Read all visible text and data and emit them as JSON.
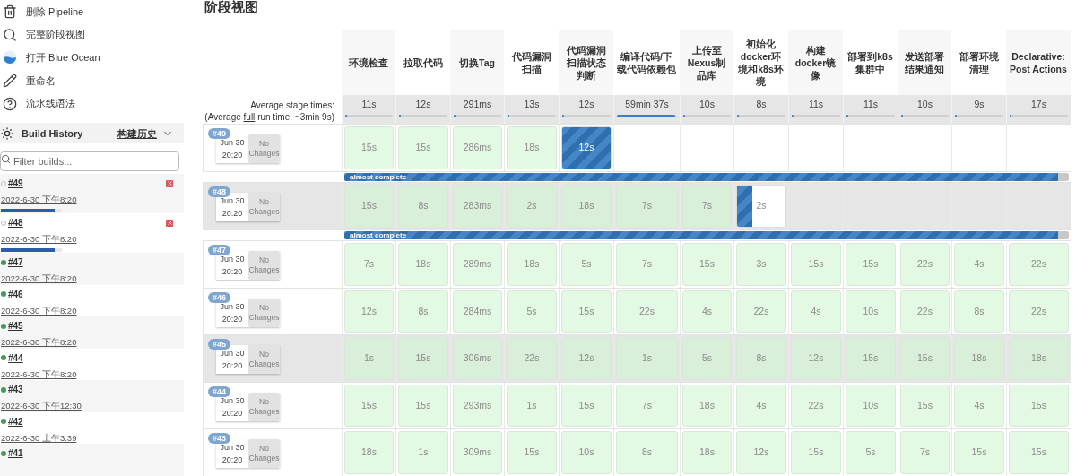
{
  "sidebar": {
    "menu": [
      {
        "kind": "trash",
        "label": "删除 Pipeline"
      },
      {
        "kind": "search",
        "label": "完整阶段视图"
      },
      {
        "kind": "ocean",
        "label": "打开 Blue Ocean"
      },
      {
        "kind": "pencil",
        "label": "重命名"
      },
      {
        "kind": "help",
        "label": "流水线语法"
      }
    ]
  },
  "build_history": {
    "title": "Build History",
    "link": "构建历史",
    "filter": {
      "placeholder": "Filter builds..."
    },
    "builds": [
      {
        "number": "#49",
        "date": "2022-6-30 下午8:20",
        "kind": "running",
        "level": 0.88,
        "cancellable": true
      },
      {
        "number": "#48",
        "date": "2022-6-30 下午8:20",
        "kind": "running",
        "level": 0.88,
        "cancellable": true
      },
      {
        "number": "#47",
        "date": "2022-6-30 下午8:20",
        "kind": "success",
        "cancellable": false
      },
      {
        "number": "#46",
        "date": "2022-6-30 下午8:20",
        "kind": "success",
        "cancellable": false
      },
      {
        "number": "#45",
        "date": "2022-6-30 下午8:20",
        "kind": "success",
        "cancellable": false
      },
      {
        "number": "#44",
        "date": "2022-6-30 下午8:20",
        "kind": "success",
        "cancellable": false
      },
      {
        "number": "#43",
        "date": "2022-6-30 下午12:30",
        "kind": "success",
        "cancellable": false
      },
      {
        "number": "#42",
        "date": "2022-6-30 上午3:39",
        "kind": "success",
        "cancellable": false
      },
      {
        "number": "#41",
        "kind": "success",
        "cancellable": false
      }
    ]
  },
  "stage_view": {
    "title": "阶段视图",
    "average_label": "Average stage times:",
    "average_note": {
      "before": "(Average",
      "link": "full",
      "after": "run time: ~3min 9s)"
    },
    "stages": [
      {
        "name": "环境检查",
        "average": "11s",
        "level": 0.03
      },
      {
        "name": "拉取代码",
        "average": "12s",
        "level": 0.03
      },
      {
        "name": "切换Tag",
        "average": "291ms",
        "level": 0.03
      },
      {
        "name": "代码漏洞扫描",
        "average": "13s",
        "level": 0.03
      },
      {
        "name": "代码漏洞扫描状态判断",
        "average": "12s",
        "level": 0.03
      },
      {
        "name": "编译代码/下载代码依赖包",
        "average": "59min 37s",
        "level": 0.97
      },
      {
        "name": "上传至Nexus制品库",
        "average": "10s",
        "level": 0.03
      },
      {
        "name": "初始化docker环境和k8s环境",
        "average": "8s",
        "level": 0.03
      },
      {
        "name": "构建docker镜像",
        "average": "11s",
        "level": 0.03
      },
      {
        "name": "部署到k8s集群中",
        "average": "11s",
        "level": 0.03
      },
      {
        "name": "发送部署结果通知",
        "average": "10s",
        "level": 0.03
      },
      {
        "name": "部署环境清理",
        "average": "9s",
        "level": 0.03
      },
      {
        "name": "Declarative: Post Actions",
        "average": "17s",
        "level": 0.03
      }
    ],
    "builds": [
      {
        "number": "#49",
        "date": "Jun 30",
        "time": "20:20",
        "changes": "No Changes",
        "shaded": false,
        "progress": {
          "label": "almost complete",
          "level": 0.985
        },
        "cells": [
          {
            "kind": "success",
            "time": "15s"
          },
          {
            "kind": "success",
            "time": "15s"
          },
          {
            "kind": "success",
            "time": "286ms"
          },
          {
            "kind": "success",
            "time": "18s"
          },
          {
            "kind": "running",
            "time": "12s",
            "level": 1
          },
          {
            "kind": "not_run"
          },
          {
            "kind": "not_run"
          },
          {
            "kind": "not_run"
          },
          {
            "kind": "not_run"
          },
          {
            "kind": "not_run"
          },
          {
            "kind": "not_run"
          },
          {
            "kind": "not_run"
          },
          {
            "kind": "not_run"
          }
        ]
      },
      {
        "number": "#48",
        "date": "Jun 30",
        "time": "20:20",
        "changes": "No Changes",
        "shaded": true,
        "progress": {
          "label": "almost complete",
          "level": 0.985
        },
        "cells": [
          {
            "kind": "success",
            "time": "15s"
          },
          {
            "kind": "success",
            "time": "8s"
          },
          {
            "kind": "success",
            "time": "283ms"
          },
          {
            "kind": "success",
            "time": "2s"
          },
          {
            "kind": "success",
            "time": "18s"
          },
          {
            "kind": "success",
            "time": "7s"
          },
          {
            "kind": "success",
            "time": "7s"
          },
          {
            "kind": "running",
            "time": "2s",
            "level": 0.32
          },
          {
            "kind": "not_run"
          },
          {
            "kind": "not_run"
          },
          {
            "kind": "not_run"
          },
          {
            "kind": "not_run"
          },
          {
            "kind": "not_run"
          }
        ]
      },
      {
        "number": "#47",
        "date": "Jun 30",
        "time": "20:20",
        "changes": "No Changes",
        "shaded": false,
        "cells": [
          {
            "kind": "success",
            "time": "7s"
          },
          {
            "kind": "success",
            "time": "18s"
          },
          {
            "kind": "success",
            "time": "289ms"
          },
          {
            "kind": "success",
            "time": "18s"
          },
          {
            "kind": "success",
            "time": "5s"
          },
          {
            "kind": "success",
            "time": "7s"
          },
          {
            "kind": "success",
            "time": "15s"
          },
          {
            "kind": "success",
            "time": "3s"
          },
          {
            "kind": "success",
            "time": "15s"
          },
          {
            "kind": "success",
            "time": "15s"
          },
          {
            "kind": "success",
            "time": "22s"
          },
          {
            "kind": "success",
            "time": "4s"
          },
          {
            "kind": "success",
            "time": "22s"
          }
        ]
      },
      {
        "number": "#46",
        "date": "Jun 30",
        "time": "20:20",
        "changes": "No Changes",
        "shaded": false,
        "cells": [
          {
            "kind": "success",
            "time": "12s"
          },
          {
            "kind": "success",
            "time": "8s"
          },
          {
            "kind": "success",
            "time": "284ms"
          },
          {
            "kind": "success",
            "time": "5s"
          },
          {
            "kind": "success",
            "time": "15s"
          },
          {
            "kind": "success",
            "time": "22s"
          },
          {
            "kind": "success",
            "time": "4s"
          },
          {
            "kind": "success",
            "time": "22s"
          },
          {
            "kind": "success",
            "time": "4s"
          },
          {
            "kind": "success",
            "time": "10s"
          },
          {
            "kind": "success",
            "time": "22s"
          },
          {
            "kind": "success",
            "time": "8s"
          },
          {
            "kind": "success",
            "time": "22s"
          }
        ]
      },
      {
        "number": "#45",
        "date": "Jun 30",
        "time": "20:20",
        "changes": "No Changes",
        "shaded": true,
        "cells": [
          {
            "kind": "success",
            "time": "1s"
          },
          {
            "kind": "success",
            "time": "15s"
          },
          {
            "kind": "success",
            "time": "306ms"
          },
          {
            "kind": "success",
            "time": "22s"
          },
          {
            "kind": "success",
            "time": "12s"
          },
          {
            "kind": "success",
            "time": "1s"
          },
          {
            "kind": "success",
            "time": "5s"
          },
          {
            "kind": "success",
            "time": "8s"
          },
          {
            "kind": "success",
            "time": "12s"
          },
          {
            "kind": "success",
            "time": "15s"
          },
          {
            "kind": "success",
            "time": "15s"
          },
          {
            "kind": "success",
            "time": "18s"
          },
          {
            "kind": "success",
            "time": "18s"
          }
        ]
      },
      {
        "number": "#44",
        "date": "Jun 30",
        "time": "20:20",
        "changes": "No Changes",
        "shaded": false,
        "cells": [
          {
            "kind": "success",
            "time": "15s"
          },
          {
            "kind": "success",
            "time": "15s"
          },
          {
            "kind": "success",
            "time": "293ms"
          },
          {
            "kind": "success",
            "time": "1s"
          },
          {
            "kind": "success",
            "time": "15s"
          },
          {
            "kind": "success",
            "time": "7s"
          },
          {
            "kind": "success",
            "time": "18s"
          },
          {
            "kind": "success",
            "time": "4s"
          },
          {
            "kind": "success",
            "time": "22s"
          },
          {
            "kind": "success",
            "time": "10s"
          },
          {
            "kind": "success",
            "time": "15s"
          },
          {
            "kind": "success",
            "time": "4s"
          },
          {
            "kind": "success",
            "time": "15s"
          }
        ]
      },
      {
        "number": "#43",
        "date": "Jun 30",
        "time": "20:20",
        "changes": "No Changes",
        "shaded": false,
        "cells": [
          {
            "kind": "success",
            "time": "18s"
          },
          {
            "kind": "success",
            "time": "1s"
          },
          {
            "kind": "success",
            "time": "309ms"
          },
          {
            "kind": "success",
            "time": "15s"
          },
          {
            "kind": "success",
            "time": "10s"
          },
          {
            "kind": "success",
            "time": "8s"
          },
          {
            "kind": "success",
            "time": "18s"
          },
          {
            "kind": "success",
            "time": "12s"
          },
          {
            "kind": "success",
            "time": "15s"
          },
          {
            "kind": "success",
            "time": "5s"
          },
          {
            "kind": "success",
            "time": "7s"
          },
          {
            "kind": "success",
            "time": "15s"
          },
          {
            "kind": "success",
            "time": "15s"
          }
        ]
      }
    ]
  }
}
